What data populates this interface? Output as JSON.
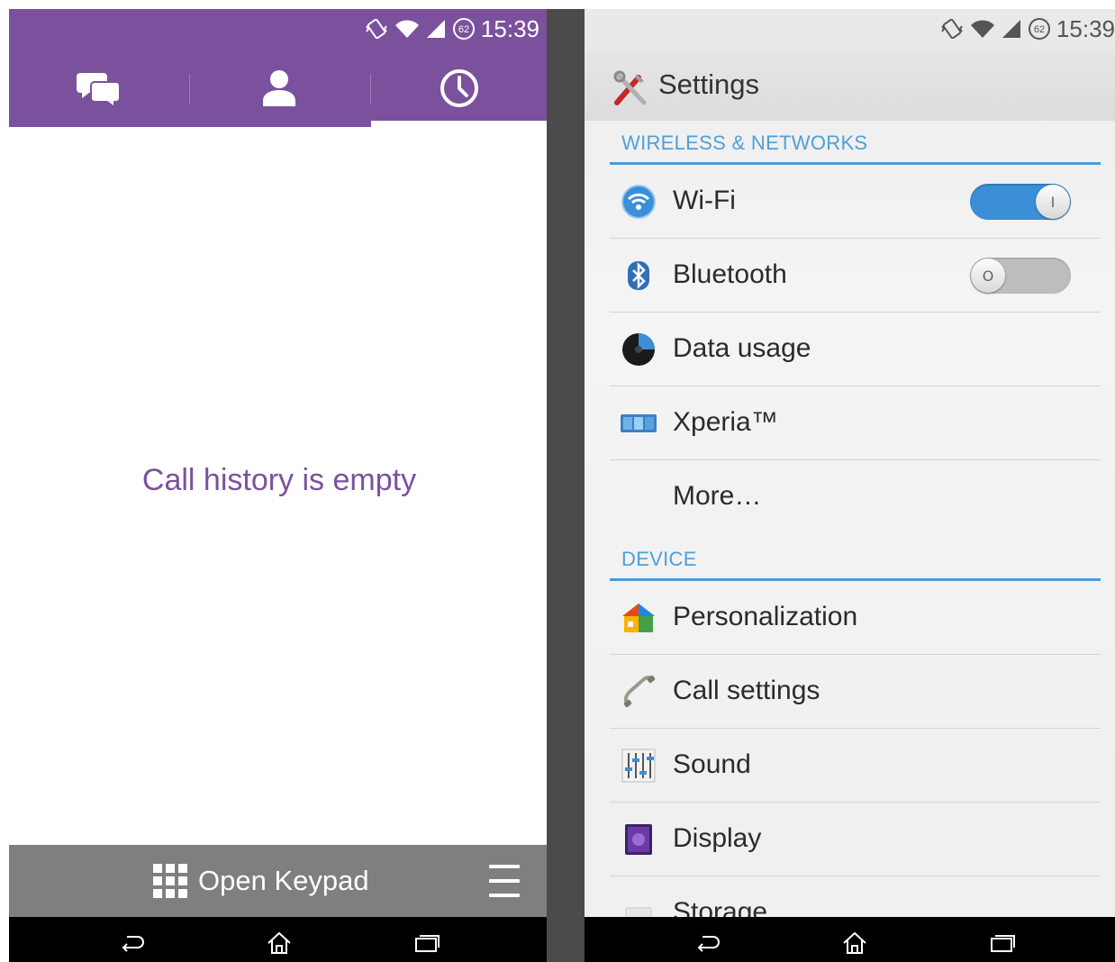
{
  "status_bar": {
    "time": "15:39",
    "battery_level": "62"
  },
  "viber": {
    "tabs": [
      {
        "name": "chats",
        "icon": "chat-bubbles-icon"
      },
      {
        "name": "contacts",
        "icon": "person-icon"
      },
      {
        "name": "recents",
        "icon": "clock-icon",
        "selected": true
      }
    ],
    "empty_message": "Call history is empty",
    "bottom_bar": {
      "keypad_label": "Open Keypad",
      "menu_icon": "hamburger-menu-icon"
    },
    "accent_color": "#7b519d"
  },
  "settings": {
    "title": "Settings",
    "sections": [
      {
        "header": "WIRELESS & NETWORKS",
        "items": [
          {
            "label": "Wi-Fi",
            "icon": "wifi-icon",
            "toggle": "on",
            "toggle_glyph": "I"
          },
          {
            "label": "Bluetooth",
            "icon": "bluetooth-icon",
            "toggle": "off",
            "toggle_glyph": "O"
          },
          {
            "label": "Data usage",
            "icon": "data-usage-icon"
          },
          {
            "label": "Xperia™",
            "icon": "xperia-icon"
          },
          {
            "label": "More…",
            "icon": ""
          }
        ]
      },
      {
        "header": "DEVICE",
        "items": [
          {
            "label": "Personalization",
            "icon": "personalization-icon"
          },
          {
            "label": "Call settings",
            "icon": "phone-handset-icon"
          },
          {
            "label": "Sound",
            "icon": "equalizer-icon"
          },
          {
            "label": "Display",
            "icon": "display-icon"
          },
          {
            "label": "Storage",
            "icon": "storage-icon"
          }
        ]
      }
    ],
    "accent_color": "#4b9bd8"
  },
  "nav_bar": {
    "buttons": [
      "back-icon",
      "home-icon",
      "recent-apps-icon"
    ]
  }
}
